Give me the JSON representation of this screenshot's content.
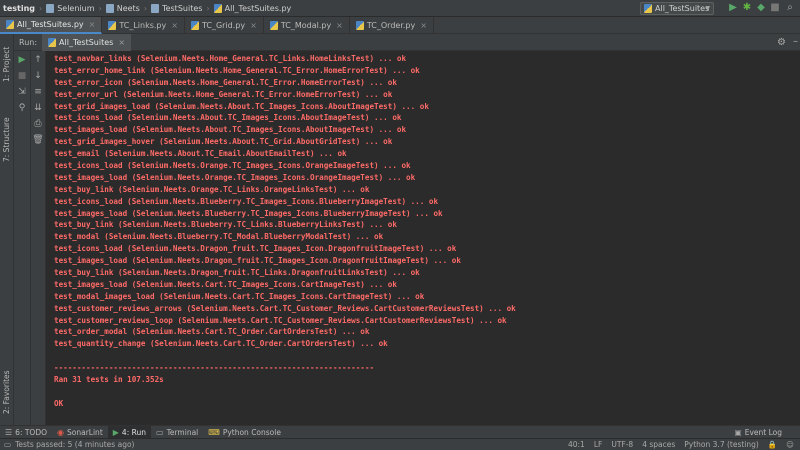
{
  "breadcrumb": [
    "testing",
    "Selenium",
    "Neets",
    "TestSuites",
    "All_TestSuites.py"
  ],
  "run_config": {
    "label": "All_TestSuites"
  },
  "tabs": [
    {
      "label": "All_TestSuites.py",
      "active": true
    },
    {
      "label": "TC_Links.py",
      "active": false
    },
    {
      "label": "TC_Grid.py",
      "active": false
    },
    {
      "label": "TC_Modal.py",
      "active": false
    },
    {
      "label": "TC_Order.py",
      "active": false
    }
  ],
  "left_stripe": {
    "project": "1: Project",
    "structure": "7: Structure",
    "favorites": "2: Favorites"
  },
  "run_panel": {
    "label": "Run:",
    "tab_label": "All_TestSuites"
  },
  "console": {
    "lines": [
      "test_navbar_links (Selenium.Neets.Home_General.TC_Links.HomeLinksTest) ... ok",
      "test_error_home_link (Selenium.Neets.Home_General.TC_Error.HomeErrorTest) ... ok",
      "test_error_icon (Selenium.Neets.Home_General.TC_Error.HomeErrorTest) ... ok",
      "test_error_url (Selenium.Neets.Home_General.TC_Error.HomeErrorTest) ... ok",
      "test_grid_images_load (Selenium.Neets.About.TC_Images_Icons.AboutImageTest) ... ok",
      "test_icons_load (Selenium.Neets.About.TC_Images_Icons.AboutImageTest) ... ok",
      "test_images_load (Selenium.Neets.About.TC_Images_Icons.AboutImageTest) ... ok",
      "test_grid_images_hover (Selenium.Neets.About.TC_Grid.AboutGridTest) ... ok",
      "test_email (Selenium.Neets.About.TC_Email.AboutEmailTest) ... ok",
      "test_icons_load (Selenium.Neets.Orange.TC_Images_Icons.OrangeImageTest) ... ok",
      "test_images_load (Selenium.Neets.Orange.TC_Images_Icons.OrangeImageTest) ... ok",
      "test_buy_link (Selenium.Neets.Orange.TC_Links.OrangeLinksTest) ... ok",
      "test_icons_load (Selenium.Neets.Blueberry.TC_Images_Icons.BlueberryImageTest) ... ok",
      "test_images_load (Selenium.Neets.Blueberry.TC_Images_Icons.BlueberryImageTest) ... ok",
      "test_buy_link (Selenium.Neets.Blueberry.TC_Links.BlueberryLinksTest) ... ok",
      "test_modal (Selenium.Neets.Blueberry.TC_Modal.BlueberryModalTest) ... ok",
      "test_icons_load (Selenium.Neets.Dragon_fruit.TC_Images_Icon.DragonfruitImageTest) ... ok",
      "test_images_load (Selenium.Neets.Dragon_fruit.TC_Images_Icon.DragonfruitImageTest) ... ok",
      "test_buy_link (Selenium.Neets.Dragon_fruit.TC_Links.DragonfruitLinksTest) ... ok",
      "test_images_load (Selenium.Neets.Cart.TC_Images_Icons.CartImageTest) ... ok",
      "test_modal_images_load (Selenium.Neets.Cart.TC_Images_Icons.CartImageTest) ... ok",
      "test_customer_reviews_arrows (Selenium.Neets.Cart.TC_Customer_Reviews.CartCustomerReviewsTest) ... ok",
      "test_customer_reviews_loop (Selenium.Neets.Cart.TC_Customer_Reviews.CartCustomerReviewsTest) ... ok",
      "test_order_modal (Selenium.Neets.Cart.TC_Order.CartOrdersTest) ... ok",
      "test_quantity_change (Selenium.Neets.Cart.TC_Order.CartOrdersTest) ... ok"
    ],
    "separator": "----------------------------------------------------------------------",
    "summary": "Ran 31 tests in 107.352s",
    "result": "OK",
    "text_color": "#ff6b68"
  },
  "bottom_tools": [
    {
      "label": "6: TODO",
      "icon": "todo-icon",
      "active": false
    },
    {
      "label": "SonarLint",
      "icon": "sonarlint-icon",
      "active": false
    },
    {
      "label": "4: Run",
      "icon": "run-icon",
      "active": true
    },
    {
      "label": "Terminal",
      "icon": "terminal-icon",
      "active": false
    },
    {
      "label": "Python Console",
      "icon": "python-console-icon",
      "active": false
    }
  ],
  "event_log": "Event Log",
  "status": {
    "message": "Tests passed: 5 (4 minutes ago)",
    "position": "40:1",
    "line_sep": "LF",
    "encoding": "UTF-8",
    "indent": "4 spaces",
    "interpreter": "Python 3.7 (testing)"
  },
  "colors": {
    "accent": "#4a88c7",
    "run_green": "#59a869",
    "debug_green": "#62b543",
    "error_text": "#ff6b68"
  }
}
